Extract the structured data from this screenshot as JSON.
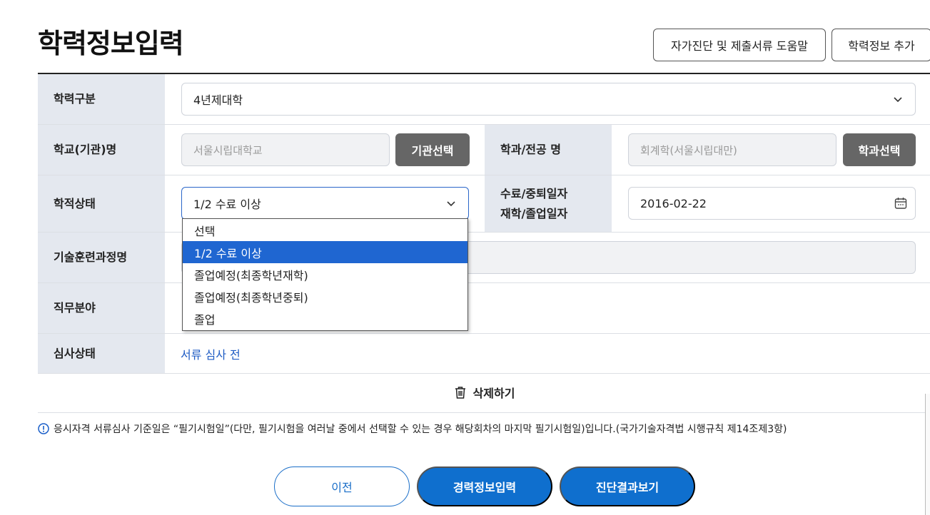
{
  "header": {
    "title": "학력정보입력",
    "help_button": "자가진단 및 제출서류 도움말",
    "add_button": "학력정보 추가"
  },
  "form": {
    "education_type": {
      "label": "학력구분",
      "value": "4년제대학"
    },
    "school": {
      "label": "학교(기관)명",
      "placeholder": "서울시립대학교",
      "button": "기관선택"
    },
    "major": {
      "label": "학과/전공 명",
      "placeholder": "회계학(서울시립대만)",
      "button": "학과선택"
    },
    "academic_status": {
      "label": "학적상태",
      "value": "1/2 수료 이상"
    },
    "date": {
      "label_line1": "수료/중퇴일자",
      "label_line2": "재학/졸업일자",
      "value": "2016-02-22"
    },
    "training_course": {
      "label": "기술훈련과정명"
    },
    "job_field": {
      "label": "직무분야"
    },
    "review_status": {
      "label": "심사상태",
      "value": "서류 심사 전"
    }
  },
  "dropdown": {
    "options": [
      "선택",
      "1/2 수료 이상",
      "졸업예정(최종학년재학)",
      "졸업예정(최종학년중퇴)",
      "졸업"
    ],
    "selected_index": 1
  },
  "delete": {
    "label": "삭제하기"
  },
  "notice": {
    "text": "응시자격 서류심사 기준일은 “필기시험일”(다만, 필기시험을 여러날 중에서 선택할 수 있는 경우 해당회차의 마지막 필기시험일)입니다.(국가기술자격법 시행규칙 제14조제3항)"
  },
  "footer": {
    "prev": "이전",
    "career": "경력정보입력",
    "result": "진단결과보기"
  },
  "colors": {
    "primary": "#0f6fce",
    "status_link": "#1f5cc4",
    "label_bg": "#e4e8ef",
    "dark_button": "#666666",
    "dropdown_selected": "#1f66d1"
  }
}
